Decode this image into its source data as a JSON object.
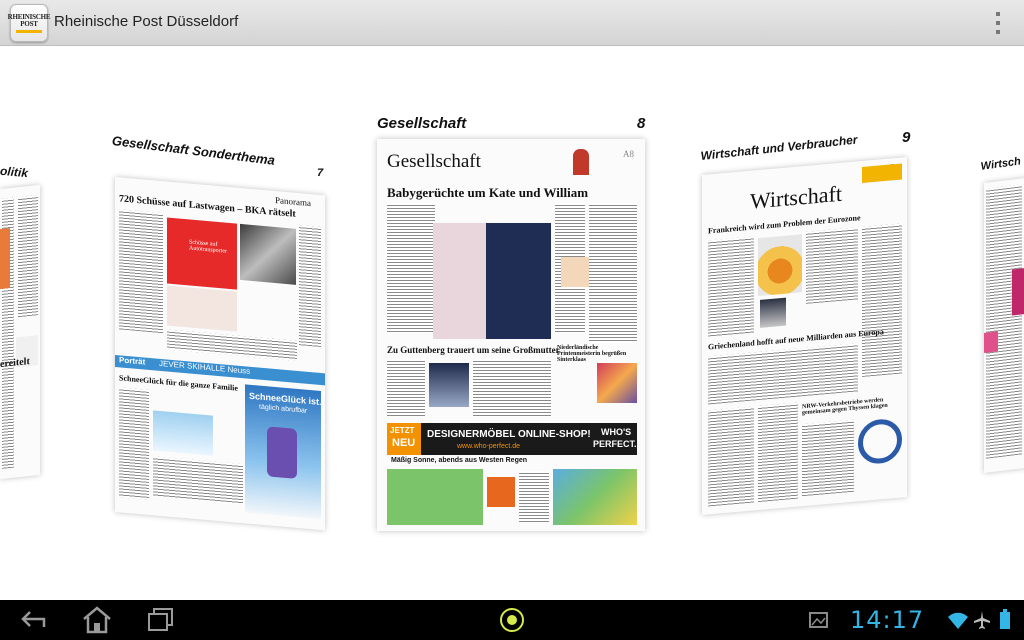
{
  "app": {
    "title": "Rheinische Post Düsseldorf",
    "icon_line1": "RHEINISCHE",
    "icon_line2": "POST"
  },
  "pages": [
    {
      "section": "olitik",
      "number": ""
    },
    {
      "section": "Gesellschaft Sonderthema",
      "number": "7",
      "masthead": "Panorama",
      "headline": "720 Schüsse auf Lastwagen – BKA rätselt",
      "ad_headline": "Schüsse auf Autotransporter",
      "strip_left": "Porträt",
      "strip_right": "JEVER SKIHALLE Neuss",
      "sub_headline": "SchneeGlück für die ganze Familie",
      "promo_title": "SchneeGlück ist...",
      "promo_sub": "täglich abrufbar"
    },
    {
      "section": "Gesellschaft",
      "number": "8",
      "masthead": "Gesellschaft",
      "page_code": "A8",
      "headline": "Babygerüchte um Kate und William",
      "headline2": "Zu Guttenberg trauert um seine Großmutter",
      "side_headline": "Niederländische Printenmeisterin begrüßen Sinterklaas",
      "ad_jetzt": "JETZT",
      "ad_neu": "NEU",
      "ad_main": "DESIGNERMÖBEL ONLINE-SHOP!",
      "ad_url": "www.who-perfect.de",
      "ad_brand1": "WHO'S",
      "ad_brand2": "PERFECT.",
      "weather": "Mäßig Sonne, abends aus Westen Regen"
    },
    {
      "section": "Wirtschaft und Verbraucher",
      "number": "9",
      "masthead": "Wirtschaft",
      "page_code": "B1",
      "headline": "Frankreich wird zum Problem der Eurozone",
      "headline2": "Griechenland hofft auf neue Milliarden aus Europa",
      "headline3": "NRW-Verkehrsbetriebe werden gemeinsam gegen Thyssen klagen"
    },
    {
      "section": "Wirtsch",
      "number": ""
    }
  ],
  "left_fragment": {
    "word": "ereitelt"
  },
  "statusbar": {
    "time": "14:17"
  },
  "colors": {
    "clock": "#33b5e5",
    "icon_accent": "#f2b400",
    "ad_orange": "#f39200"
  },
  "nav": {
    "back": "back-icon",
    "home": "home-icon",
    "recent": "recent-apps-icon",
    "center": "app-launcher-icon"
  }
}
